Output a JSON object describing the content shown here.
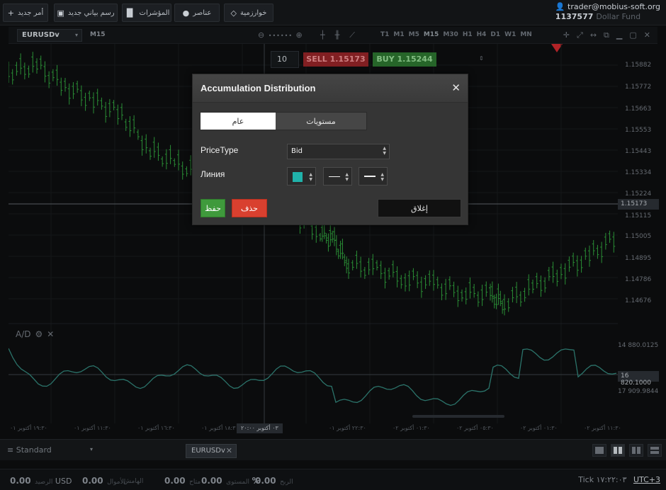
{
  "toolbar": {
    "new_order": "أمر جديد",
    "new_chart": "رسم بياني جديد",
    "indicators": "المؤشرات",
    "elements": "عناصر",
    "algorithms": "خوارزمية"
  },
  "account": {
    "email": "trader@mobius-soft.org",
    "number": "1137577",
    "fund": "Dollar Fund"
  },
  "chart_header": {
    "symbol": "EURUSDv",
    "timeframe": "M15",
    "zoom_dots": "••••••",
    "timeframes": [
      "T1",
      "M1",
      "M5",
      "M15",
      "M30",
      "H1",
      "H4",
      "D1",
      "W1",
      "MN"
    ]
  },
  "trade": {
    "lot": "10",
    "sell": "SELL 1.15173",
    "buy": "BUY 1.15244"
  },
  "price_axis": {
    "labels": [
      "1.15882",
      "1.15772",
      "1.15663",
      "1.15553",
      "1.15443",
      "1.15334",
      "1.15224",
      "1.15115",
      "1.15005",
      "1.14895",
      "1.14786",
      "1.14676"
    ],
    "current_price": "1.15173"
  },
  "indicator_axis": {
    "labels": [
      "14 880.0125",
      "17 909.9844"
    ],
    "current_value": "16 820.1000",
    "name": "A/D"
  },
  "time_axis": {
    "labels": [
      "١٩:٣٠ أكتوبر ٠١",
      "١١:٣٠ أكتوبر ٠١",
      "١٦:٣٠ أكتوبر ٠١",
      "١٨:٣٠ أكتوبر ٠١",
      "٢٢:٣٠ أكتوبر ٠١",
      "٠١:٣٠ أكتوبر ٠٢",
      "٠٥:٣٠ أكتوبر ٠٢",
      "٠١:٣٠ أكتوبر ٠٢",
      "١١:٣٠ أكتوبر ٠٢"
    ],
    "cursor_time": "٠٣ أكتوبر ٢٠:٠٠"
  },
  "modal": {
    "title": "Accumulation Distribution",
    "tab_general": "عام",
    "tab_levels": "مستويات",
    "price_type_label": "PriceType",
    "price_type_value": "Bid",
    "line_label": "Линия",
    "line_color": "#20b2aa",
    "save": "حفظ",
    "delete": "حذف",
    "close": "إغلاق"
  },
  "bottom": {
    "profile": "Standard",
    "symbol_tab": "EURUSDv"
  },
  "status": {
    "balance_value": "0.00",
    "currency": "USD",
    "balance_label": "الرصيد",
    "equity_value": "0.00",
    "equity_label": "الأموال",
    "margin_value": "0.00",
    "margin_label": "الهامش",
    "free_value": "0.00",
    "free_label": "متاح",
    "level_value": "%",
    "level_label": "المستوى",
    "profit_value": "0.00",
    "profit_label": "الربح",
    "tick": "Tick ١٧:٢٢:٠٣",
    "utc": "UTC+3"
  },
  "colors": {
    "candle": "#2e9a3a",
    "indicator": "#2f7d73",
    "sell": "#8c2225",
    "buy": "#2a6e2d",
    "accent_red": "#c0262b"
  }
}
